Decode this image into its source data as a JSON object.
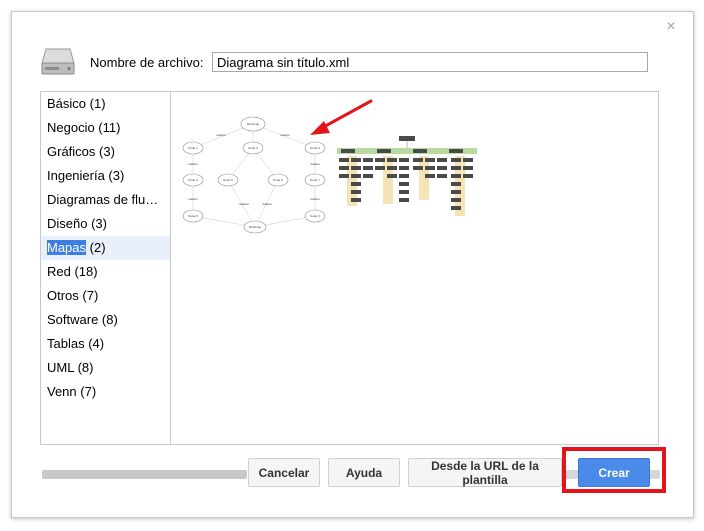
{
  "dialog": {
    "close_icon": "close-icon",
    "drive_icon": "hard-drive-icon",
    "filename_label": "Nombre de archivo:",
    "filename_value": "Diagrama sin título.xml"
  },
  "categories": [
    {
      "label": "Básico (1)"
    },
    {
      "label": "Negocio (11)"
    },
    {
      "label": "Gráficos (3)"
    },
    {
      "label": "Ingeniería (3)"
    },
    {
      "label": "Diagramas de flu…"
    },
    {
      "label": "Diseño (3)"
    },
    {
      "name": "Mapas",
      "count": "(2)",
      "selected": true
    },
    {
      "label": "Red (18)"
    },
    {
      "label": "Otros (7)"
    },
    {
      "label": "Software (8)"
    },
    {
      "label": "Tablas (4)"
    },
    {
      "label": "UML (8)"
    },
    {
      "label": "Venn (7)"
    }
  ],
  "templates": {
    "mindmap": {
      "center": "Mindmap",
      "nodes": [
        "Node 1",
        "Node 2",
        "Node 3",
        "Node 4",
        "Node 5",
        "Node 6",
        "Node 7",
        "Node 8",
        "Node 9"
      ],
      "bottom": "Mindmap",
      "edge_label": "relation"
    },
    "orgchart": {}
  },
  "buttons": {
    "cancel": "Cancelar",
    "help": "Ayuda",
    "from_url": "Desde la URL de la plantilla",
    "create": "Crear"
  },
  "colors": {
    "primary_button": "#4a8ae8",
    "selection": "#3d7ee0",
    "annotation_red": "#e4141b"
  }
}
